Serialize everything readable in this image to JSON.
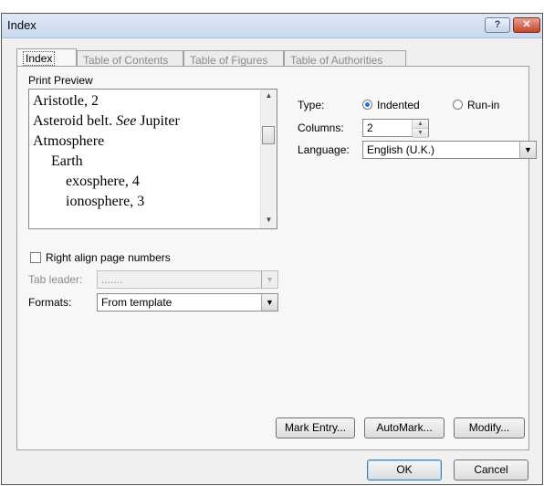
{
  "window": {
    "title": "Index",
    "help_glyph": "?",
    "close_glyph": "✕"
  },
  "tabs": [
    {
      "label": "Index"
    },
    {
      "label": "Table of Contents"
    },
    {
      "label": "Table of Figures"
    },
    {
      "label": "Table of Authorities"
    }
  ],
  "print_preview": {
    "label": "Print Preview",
    "lines": [
      {
        "text": "Aristotle, 2"
      },
      {
        "text_before": "Asteroid belt. ",
        "italic": "See",
        "text_after": " Jupiter"
      },
      {
        "text": "Atmosphere"
      },
      {
        "text": "Earth"
      },
      {
        "text": "exosphere, 4"
      },
      {
        "text": "ionosphere, 3"
      }
    ]
  },
  "type": {
    "label": "Type:",
    "options": [
      "Indented",
      "Run-in"
    ],
    "selected": "Indented"
  },
  "columns": {
    "label": "Columns:",
    "value": "2"
  },
  "language": {
    "label": "Language:",
    "value": "English (U.K.)"
  },
  "right_align": {
    "label": "Right align page numbers",
    "checked": false
  },
  "tab_leader": {
    "label": "Tab leader:",
    "value": "......."
  },
  "formats": {
    "label": "Formats:",
    "value": "From template"
  },
  "buttons": {
    "mark_entry": "Mark Entry...",
    "automark": "AutoMark...",
    "modify": "Modify...",
    "ok": "OK",
    "cancel": "Cancel"
  }
}
